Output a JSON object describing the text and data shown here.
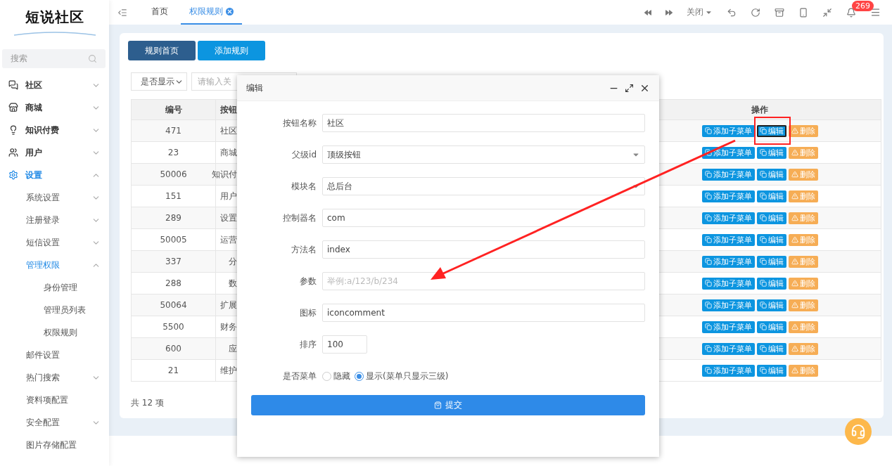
{
  "sidebar": {
    "logo": "短说社区",
    "search": {
      "placeholder": "搜索"
    },
    "items": [
      {
        "label": "社区",
        "kind": "folder",
        "expanded": false,
        "active": false
      },
      {
        "label": "商城",
        "kind": "folder",
        "expanded": false,
        "active": false
      },
      {
        "label": "知识付费",
        "kind": "folder",
        "expanded": false,
        "active": false
      },
      {
        "label": "用户",
        "kind": "folder",
        "expanded": false,
        "active": false
      },
      {
        "label": "设置",
        "kind": "folder",
        "expanded": true,
        "active": true,
        "children": [
          {
            "label": "系统设置",
            "kind": "folder",
            "expanded": false,
            "active": false
          },
          {
            "label": "注册登录",
            "kind": "folder",
            "expanded": false,
            "active": false
          },
          {
            "label": "短信设置",
            "kind": "folder",
            "expanded": false,
            "active": false
          },
          {
            "label": "管理权限",
            "kind": "folder",
            "expanded": true,
            "active": true,
            "children": [
              {
                "label": "身份管理",
                "kind": "page",
                "active": false
              },
              {
                "label": "管理员列表",
                "kind": "page",
                "active": false
              },
              {
                "label": "权限规则",
                "kind": "page",
                "active": false
              }
            ]
          },
          {
            "label": "邮件设置",
            "kind": "page",
            "active": false
          },
          {
            "label": "热门搜索",
            "kind": "folder",
            "expanded": false,
            "active": false
          },
          {
            "label": "资料项配置",
            "kind": "page",
            "active": false
          },
          {
            "label": "安全配置",
            "kind": "folder",
            "expanded": false,
            "active": false
          },
          {
            "label": "图片存储配置",
            "kind": "page",
            "active": false
          }
        ]
      }
    ]
  },
  "topbar": {
    "tabs": [
      {
        "label": "首页",
        "selected": false,
        "closable": false
      },
      {
        "label": "权限规则",
        "selected": true,
        "closable": true
      }
    ],
    "close_menu": "关闭",
    "notification_count": "269"
  },
  "page": {
    "buttons": [
      {
        "label": "规则首页",
        "selected": true
      },
      {
        "label": "添加规则",
        "selected": false
      }
    ],
    "filter": {
      "select": "是否显示",
      "search_placeholder": "请输入关"
    },
    "table": {
      "columns": [
        "编号",
        "按钮",
        "操作"
      ],
      "rows": [
        {
          "id": "471",
          "name": "社区",
          "highlighted": true,
          "actions": [
            "添加子菜单",
            "编辑",
            "删除"
          ]
        },
        {
          "id": "23",
          "name": "商城",
          "highlighted": false,
          "actions": [
            "添加子菜单",
            "编辑",
            "删除"
          ]
        },
        {
          "id": "50006",
          "name": "知识付",
          "highlighted": false,
          "actions": [
            "添加子菜单",
            "编辑",
            "删除"
          ]
        },
        {
          "id": "151",
          "name": "用户",
          "highlighted": false,
          "actions": [
            "添加子菜单",
            "编辑",
            "删除"
          ]
        },
        {
          "id": "289",
          "name": "设置",
          "highlighted": false,
          "actions": [
            "添加子菜单",
            "编辑",
            "删除"
          ]
        },
        {
          "id": "50005",
          "name": "运营",
          "highlighted": false,
          "actions": [
            "添加子菜单",
            "编辑",
            "删除"
          ]
        },
        {
          "id": "337",
          "name": "分",
          "highlighted": false,
          "actions": [
            "添加子菜单",
            "编辑",
            "删除"
          ]
        },
        {
          "id": "288",
          "name": "数",
          "highlighted": false,
          "actions": [
            "添加子菜单",
            "编辑",
            "删除"
          ]
        },
        {
          "id": "50064",
          "name": "扩展",
          "highlighted": false,
          "actions": [
            "添加子菜单",
            "编辑",
            "删除"
          ]
        },
        {
          "id": "5500",
          "name": "财务",
          "highlighted": false,
          "actions": [
            "添加子菜单",
            "编辑",
            "删除"
          ]
        },
        {
          "id": "600",
          "name": "应",
          "highlighted": false,
          "actions": [
            "添加子菜单",
            "编辑",
            "删除"
          ]
        },
        {
          "id": "21",
          "name": "维护",
          "highlighted": false,
          "actions": [
            "添加子菜单",
            "编辑",
            "删除"
          ]
        }
      ]
    },
    "total": "共 12 项"
  },
  "dialog": {
    "title": "编辑",
    "fields": [
      {
        "kind": "text",
        "label": "按钮名称",
        "value": "社区"
      },
      {
        "kind": "select",
        "label": "父级id",
        "value": "顶级按钮"
      },
      {
        "kind": "select",
        "label": "模块名",
        "value": "总后台"
      },
      {
        "kind": "text",
        "label": "控制器名",
        "value": "com"
      },
      {
        "kind": "text",
        "label": "方法名",
        "value": "index"
      },
      {
        "kind": "text",
        "label": "参数",
        "placeholder": "举例:a/123/b/234"
      },
      {
        "kind": "text",
        "label": "图标",
        "value": "iconcomment"
      },
      {
        "kind": "short",
        "label": "排序",
        "value": "100"
      },
      {
        "kind": "radio",
        "label": "是否菜单",
        "options": [
          {
            "label": "隐藏",
            "selected": false
          },
          {
            "label": "显示(菜单只显示三级)",
            "selected": true
          }
        ]
      }
    ],
    "submit": "提交"
  }
}
